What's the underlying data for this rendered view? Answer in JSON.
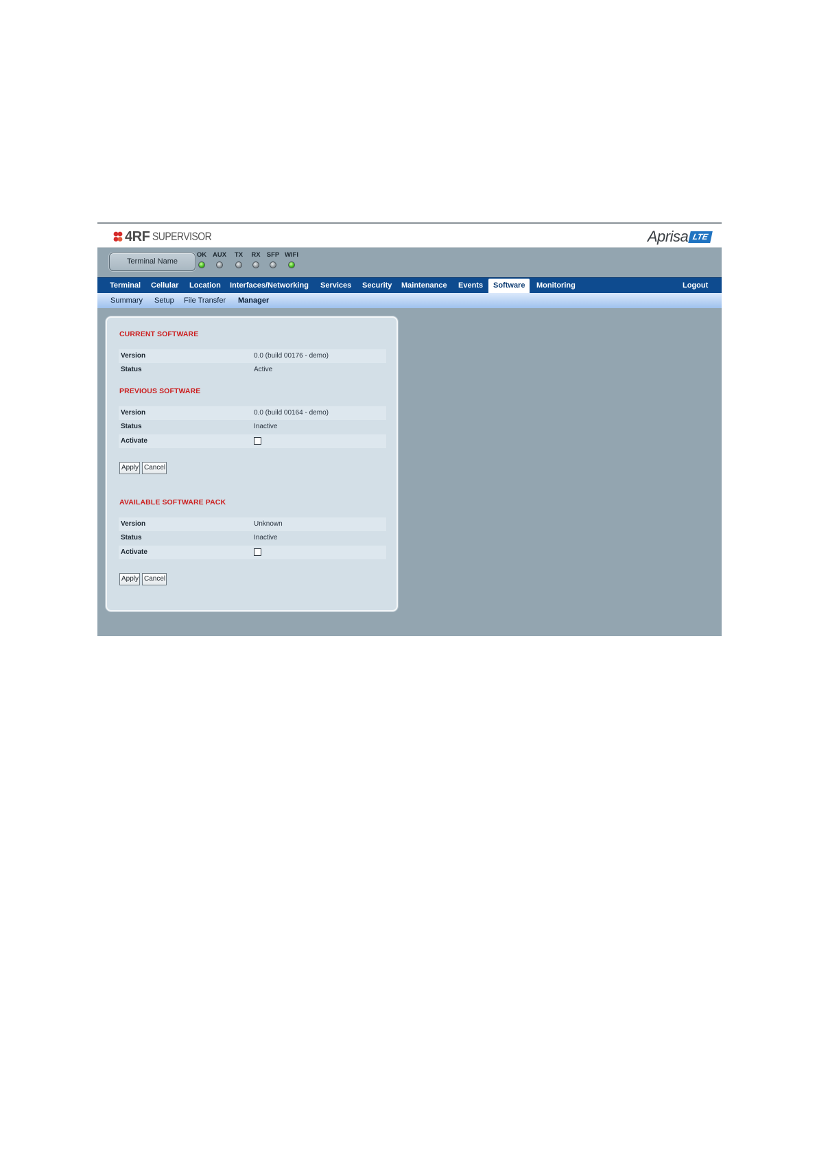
{
  "brand": {
    "vendor_logo": "4RF",
    "product_name": "SUPERVISOR",
    "radio_logo": "Aprisa",
    "radio_badge": "LTE"
  },
  "terminal_name_button": "Terminal Name",
  "indicators": [
    {
      "label": "OK",
      "state": "green"
    },
    {
      "label": "AUX",
      "state": "grey"
    },
    {
      "label": "TX",
      "state": "grey"
    },
    {
      "label": "RX",
      "state": "grey"
    },
    {
      "label": "SFP",
      "state": "grey"
    },
    {
      "label": "WIFI",
      "state": "green"
    }
  ],
  "nav": {
    "items": [
      "Terminal",
      "Cellular",
      "Location",
      "Interfaces/Networking",
      "Services",
      "Security",
      "Maintenance",
      "Events",
      "Software",
      "Monitoring"
    ],
    "active": "Software",
    "logout": "Logout"
  },
  "subnav": {
    "items": [
      "Summary",
      "Setup",
      "File Transfer",
      "Manager"
    ],
    "active": "Manager"
  },
  "sections": {
    "current": {
      "title": "CURRENT SOFTWARE",
      "version_label": "Version",
      "version_value": "0.0 (build 00176 - demo)",
      "status_label": "Status",
      "status_value": "Active"
    },
    "previous": {
      "title": "PREVIOUS SOFTWARE",
      "version_label": "Version",
      "version_value": "0.0 (build 00164 - demo)",
      "status_label": "Status",
      "status_value": "Inactive",
      "activate_label": "Activate",
      "activate_checked": false,
      "apply": "Apply",
      "cancel": "Cancel"
    },
    "available": {
      "title": "AVAILABLE SOFTWARE PACK",
      "version_label": "Version",
      "version_value": "Unknown",
      "status_label": "Status",
      "status_value": "Inactive",
      "activate_label": "Activate",
      "activate_checked": false,
      "apply": "Apply",
      "cancel": "Cancel"
    }
  },
  "colors": {
    "nav_bg": "#0e4b8f",
    "section_title": "#cc1f1f",
    "page_bg": "#93a5b0",
    "led_on": "#3fb81b"
  }
}
